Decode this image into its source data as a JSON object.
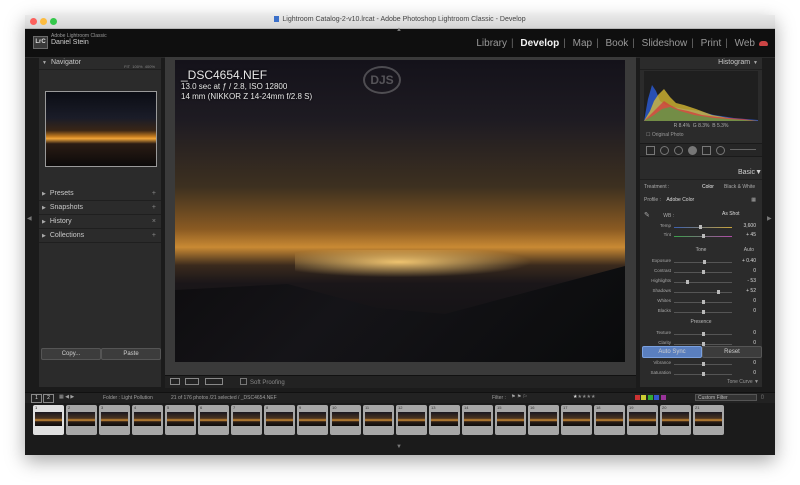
{
  "window": {
    "title": "Lightroom Catalog-2-v10.lrcat - Adobe Photoshop Lightroom Classic - Develop"
  },
  "identity": {
    "logo": "LrC",
    "app_name": "Adobe Lightroom Classic",
    "user": "Daniel Stein"
  },
  "modules": [
    "Library",
    "Develop",
    "Map",
    "Book",
    "Slideshow",
    "Print",
    "Web"
  ],
  "active_module": "Develop",
  "left_panel": {
    "navigator": {
      "title": "Navigator",
      "options": [
        "FIT",
        "100%",
        "400%"
      ]
    },
    "sections": [
      {
        "label": "Presets"
      },
      {
        "label": "Snapshots"
      },
      {
        "label": "History"
      },
      {
        "label": "Collections"
      }
    ],
    "copy_button": "Copy...",
    "paste_button": "Paste"
  },
  "photo": {
    "filename": "_DSC4654.NEF",
    "exposure": "13.0 sec at ƒ / 2.8, ISO 12800",
    "lens": "14 mm (NIKKOR Z 14-24mm f/2.8 S)",
    "watermark": "DJS"
  },
  "toolbar": {
    "soft_proofing": "Soft Proofing"
  },
  "right_panel": {
    "histogram_title": "Histogram",
    "histogram_info": [
      "R",
      "8.4",
      "%",
      "G",
      "8.3",
      "%",
      "B",
      "5.3",
      "%"
    ],
    "original_photo": "Original Photo",
    "basic_title": "Basic",
    "treatment_label": "Treatment :",
    "treatment_options": [
      "Color",
      "Black & White"
    ],
    "profile_label": "Profile :",
    "profile_value": "Adobe Color",
    "wb_label": "WB :",
    "wb_value": "As Shot",
    "temp": {
      "label": "Temp",
      "value": "3,600",
      "pos": 0.45
    },
    "tint": {
      "label": "Tint",
      "value": "+ 45",
      "pos": 0.5
    },
    "tone_label": "Tone",
    "auto_label": "Auto",
    "sliders": [
      {
        "label": "Exposure",
        "value": "+ 0.40",
        "pos": 0.53
      },
      {
        "label": "Contrast",
        "value": "0",
        "pos": 0.5
      },
      {
        "label": "Highlights",
        "value": "- 53",
        "pos": 0.24
      },
      {
        "label": "Shadows",
        "value": "+ 52",
        "pos": 0.76
      },
      {
        "label": "Whites",
        "value": "0",
        "pos": 0.5
      },
      {
        "label": "Blacks",
        "value": "0",
        "pos": 0.5
      }
    ],
    "presence_label": "Presence",
    "presence": [
      {
        "label": "Texture",
        "value": "0",
        "pos": 0.5
      },
      {
        "label": "Clarity",
        "value": "0",
        "pos": 0.5
      },
      {
        "label": "Dehaze",
        "value": "0",
        "pos": 0.5
      },
      {
        "label": "Vibrance",
        "value": "0",
        "pos": 0.5
      },
      {
        "label": "Saturation",
        "value": "0",
        "pos": 0.5
      }
    ],
    "tone_curve": "Tone Curve",
    "auto_sync": "Auto Sync",
    "reset": "Reset"
  },
  "filmstrip_bar": {
    "folder_label": "Folder : Light Pollution",
    "count_text": "21 of 176 photos /21 selected / _DSC4654.NEF",
    "filter_label": "Filter :",
    "custom_filter": "Custom Filter",
    "rating_on": 1,
    "rating_max": 5
  },
  "filmstrip": {
    "count": 21,
    "selected_index": 0,
    "numbers": [
      "1",
      "2",
      "3",
      "4",
      "5",
      "6",
      "7",
      "8",
      "9",
      "10",
      "11",
      "12",
      "13",
      "14",
      "15",
      "16",
      "17",
      "18",
      "19",
      "20",
      "21"
    ]
  },
  "colors": {
    "accent": "#3c70c9",
    "panel_bg": "#2b2b2b",
    "window_bg": "#1b1b1b"
  }
}
